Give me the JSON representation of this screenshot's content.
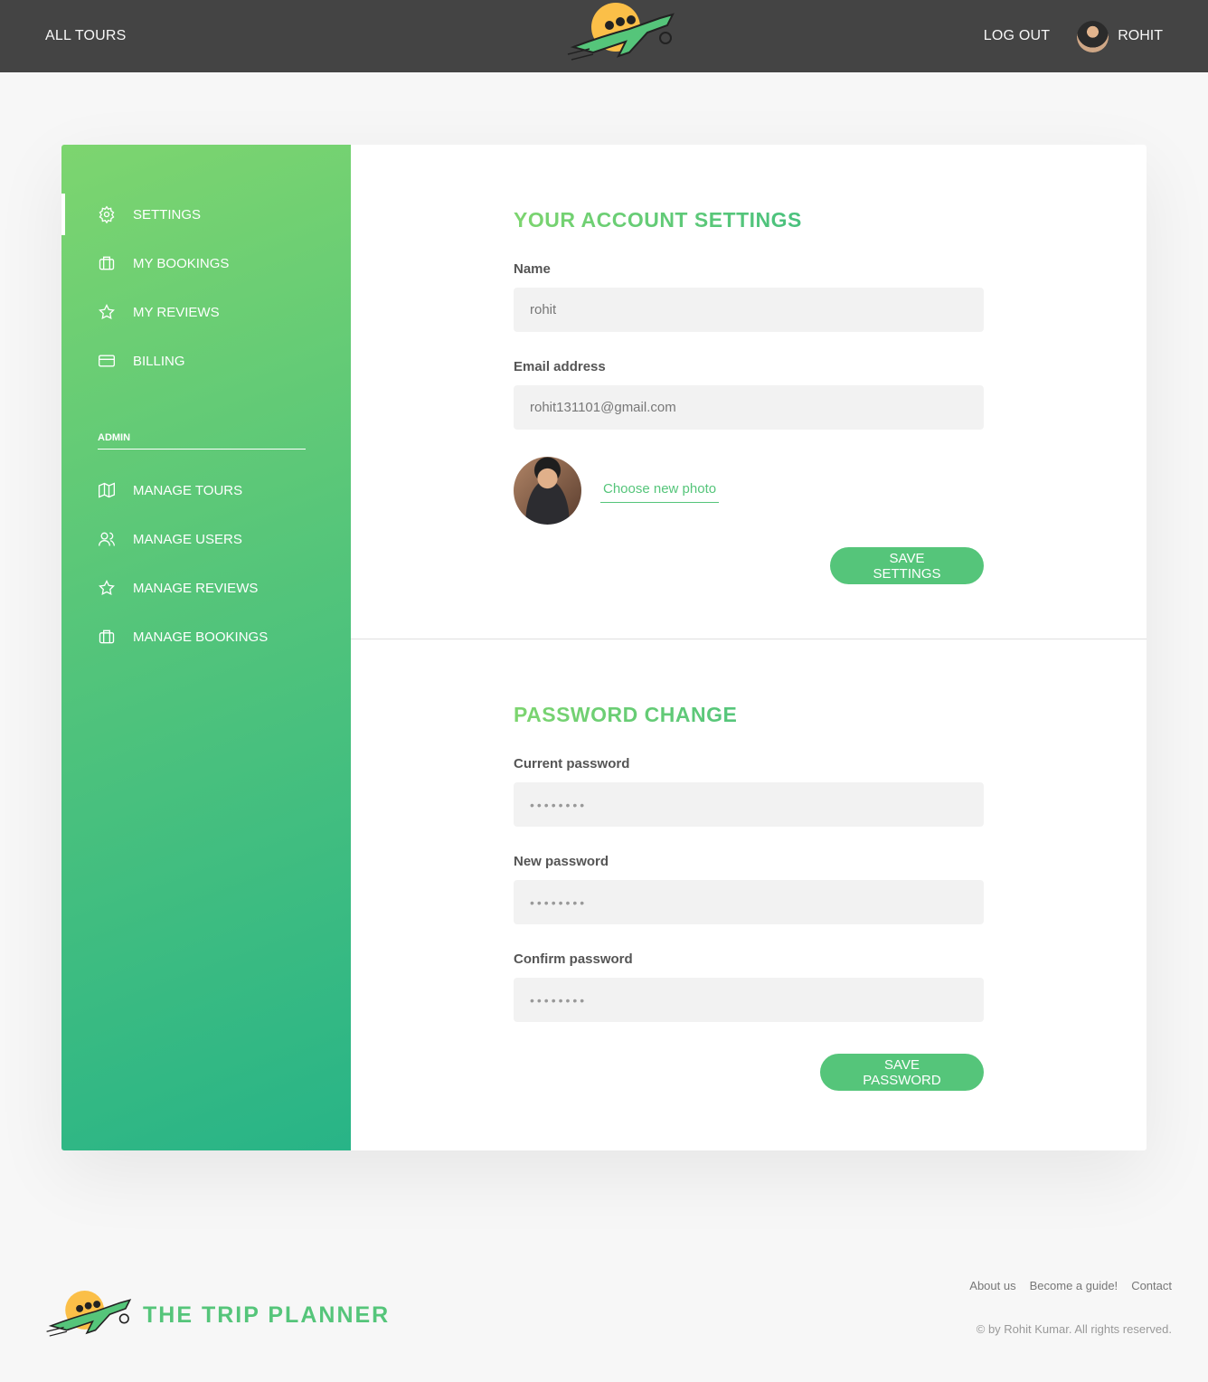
{
  "header": {
    "all_tours": "ALL TOURS",
    "log_out": "LOG OUT",
    "user_name": "ROHIT"
  },
  "sidebar": {
    "items": [
      {
        "label": "SETTINGS",
        "icon": "settings-icon",
        "active": true
      },
      {
        "label": "MY BOOKINGS",
        "icon": "briefcase-icon"
      },
      {
        "label": "MY REVIEWS",
        "icon": "star-icon"
      },
      {
        "label": "BILLING",
        "icon": "credit-card-icon"
      }
    ],
    "admin_label": "ADMIN",
    "admin_items": [
      {
        "label": "MANAGE TOURS",
        "icon": "map-icon"
      },
      {
        "label": "MANAGE USERS",
        "icon": "users-icon"
      },
      {
        "label": "MANAGE REVIEWS",
        "icon": "star-icon"
      },
      {
        "label": "MANAGE BOOKINGS",
        "icon": "briefcase-icon"
      }
    ]
  },
  "account": {
    "title": "YOUR ACCOUNT SETTINGS",
    "name_label": "Name",
    "name_value": "rohit",
    "email_label": "Email address",
    "email_value": "rohit131101@gmail.com",
    "photo_link": "Choose new photo",
    "save_label": "SAVE SETTINGS"
  },
  "password": {
    "title": "PASSWORD CHANGE",
    "current_label": "Current password",
    "new_label": "New password",
    "confirm_label": "Confirm password",
    "mask": "••••••••",
    "save_label": "SAVE PASSWORD"
  },
  "footer": {
    "brand": "THE TRIP PLANNER",
    "links": [
      "About us",
      "Become a guide!",
      "Contact"
    ],
    "copyright": "© by Rohit Kumar. All rights reserved."
  },
  "colors": {
    "header_bg": "#444444",
    "accent": "#55c57a",
    "accent_light": "#7dd56f",
    "accent_dark": "#28b487"
  }
}
